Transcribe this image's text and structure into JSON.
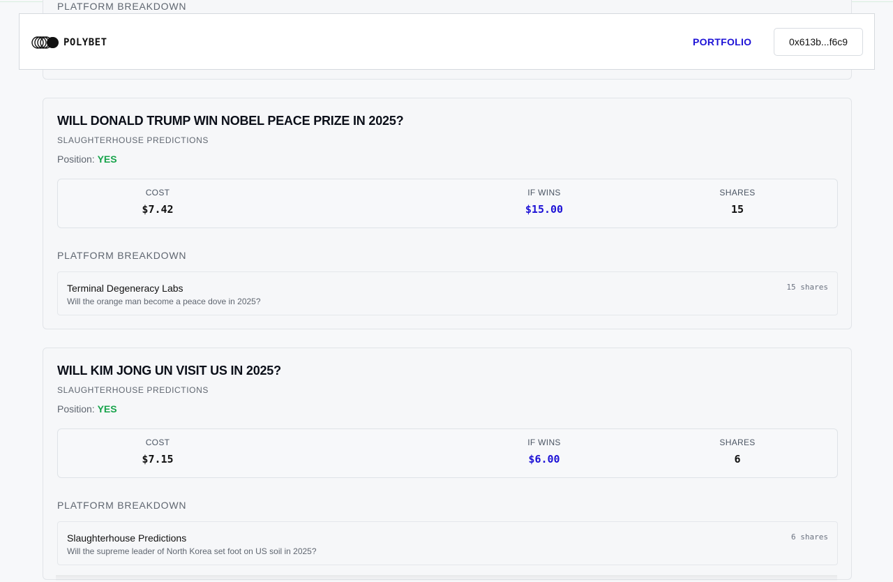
{
  "header": {
    "logo_text": "POLYBET",
    "portfolio_label": "PORTFOLIO",
    "wallet_label": "0x613b...f6c9"
  },
  "previous_card": {
    "breakdown_title": "PLATFORM BREAKDOWN"
  },
  "positions": [
    {
      "title": "WILL DONALD TRUMP WIN NOBEL PEACE PRIZE IN 2025?",
      "source": "SLAUGHTERHOUSE PREDICTIONS",
      "position_label": "Position:",
      "position_value": "YES",
      "cost_label": "COST",
      "cost_value": "$7.42",
      "wins_label": "IF WINS",
      "wins_value": "$15.00",
      "shares_label": "SHARES",
      "shares_value": "15",
      "breakdown_title": "PLATFORM BREAKDOWN",
      "breakdown": {
        "platform": "Terminal Degeneracy Labs",
        "description": "Will the orange man become a peace dove in 2025?",
        "shares": "15 shares"
      }
    },
    {
      "title": "WILL KIM JONG UN VISIT US IN 2025?",
      "source": "SLAUGHTERHOUSE PREDICTIONS",
      "position_label": "Position:",
      "position_value": "YES",
      "cost_label": "COST",
      "cost_value": "$7.15",
      "wins_label": "IF WINS",
      "wins_value": "$6.00",
      "shares_label": "SHARES",
      "shares_value": "6",
      "breakdown_title": "PLATFORM BREAKDOWN",
      "breakdown": {
        "platform": "Slaughterhouse Predictions",
        "description": "Will the supreme leader of North Korea set foot on US soil in 2025?",
        "shares": "6 shares"
      }
    }
  ],
  "colors": {
    "accent": "#1d12d6",
    "position_yes": "#16a34a"
  }
}
